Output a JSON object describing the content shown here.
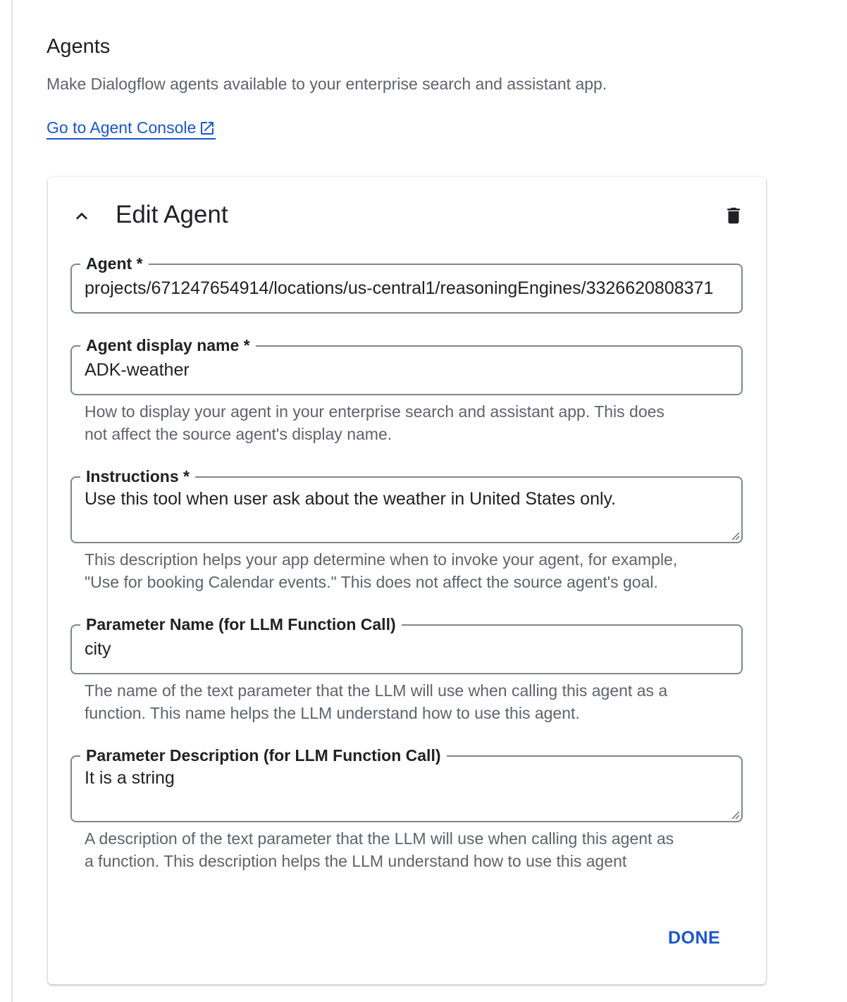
{
  "section": {
    "title": "Agents",
    "description": "Make Dialogflow agents available to your enterprise search and assistant app.",
    "console_link": "Go to Agent Console"
  },
  "card": {
    "title": "Edit Agent",
    "done_label": "DONE"
  },
  "fields": {
    "agent": {
      "label": "Agent *",
      "value": "projects/671247654914/locations/us-central1/reasoningEngines/3326620808371"
    },
    "display_name": {
      "label": "Agent display name *",
      "value": "ADK-weather",
      "hint_line1": "How to display your agent in your enterprise search and assistant app. This does",
      "hint_line2": "not affect the source agent's display name."
    },
    "instructions": {
      "label": "Instructions *",
      "value": "Use this tool when user ask about the weather in United States only.",
      "hint_line1": "This description helps your app determine when to invoke your agent, for example,",
      "hint_line2": "\"Use for booking Calendar events.\" This does not affect the source agent's goal."
    },
    "parameter_name": {
      "label": "Parameter Name (for LLM Function Call)",
      "value": "city",
      "hint_line1": "The name of the text parameter that the LLM will use when calling this agent as a",
      "hint_line2": "function. This name helps the LLM understand how to use this agent."
    },
    "parameter_description": {
      "label": "Parameter Description (for LLM Function Call)",
      "value": "It is a string",
      "hint_line1": "A description of the text parameter that the LLM will use when calling this agent as",
      "hint_line2": "a function. This description helps the LLM understand how to use this agent"
    }
  },
  "icons": {
    "external": "external-link-icon",
    "collapse": "chevron-up-icon",
    "delete": "trash-icon"
  },
  "colors": {
    "link": "#1a56c8",
    "border": "#80868b",
    "hint": "#5f6368"
  }
}
